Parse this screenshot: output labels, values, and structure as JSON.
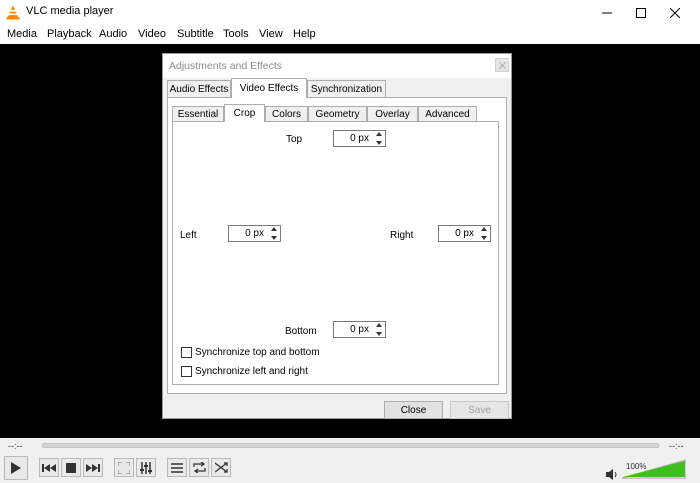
{
  "window": {
    "title": "VLC media player"
  },
  "menu": [
    "Media",
    "Playback",
    "Audio",
    "Video",
    "Subtitle",
    "Tools",
    "View",
    "Help"
  ],
  "dialog": {
    "title": "Adjustments and Effects",
    "tabs": [
      "Audio Effects",
      "Video Effects",
      "Synchronization"
    ],
    "active_tab": "Video Effects",
    "subtabs": [
      "Essential",
      "Crop",
      "Colors",
      "Geometry",
      "Overlay",
      "Advanced"
    ],
    "active_subtab": "Crop",
    "crop": {
      "top_label": "Top",
      "top_value": "0 px",
      "left_label": "Left",
      "left_value": "0 px",
      "right_label": "Right",
      "right_value": "0 px",
      "bottom_label": "Bottom",
      "bottom_value": "0 px",
      "sync_tb_label": "Synchronize top and bottom",
      "sync_lr_label": "Synchronize left and right"
    },
    "close_label": "Close",
    "save_label": "Save"
  },
  "player": {
    "elapsed": "--:--",
    "remaining": "--:--",
    "volume_label": "100%",
    "volume_level": 1.0
  },
  "colors": {
    "accent": "#ff8800",
    "video_bg": "#000000",
    "volume_green": "#3fbf1f"
  }
}
